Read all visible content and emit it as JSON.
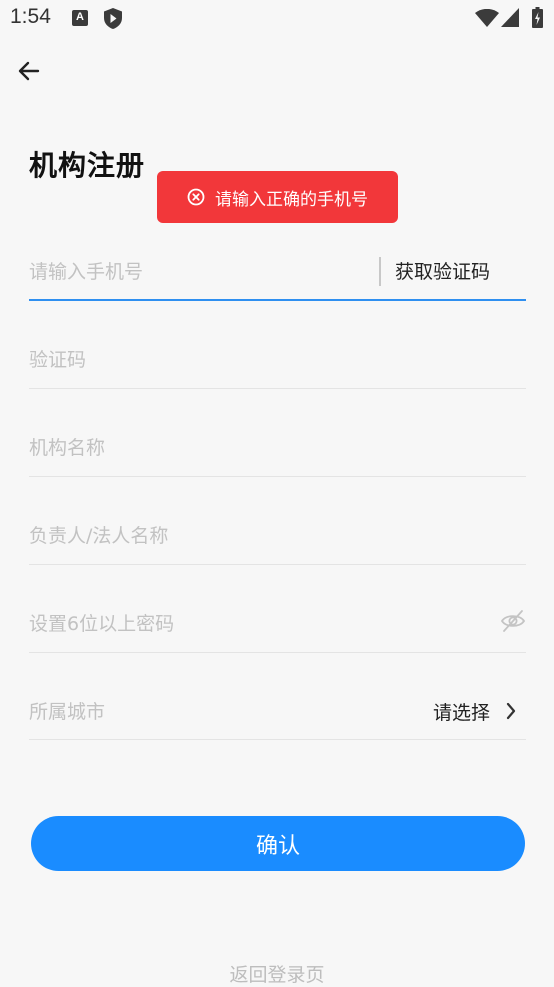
{
  "status_bar": {
    "time": "1:54",
    "a_icon_letter": "A",
    "icons": [
      "a-icon",
      "shield-icon",
      "wifi-icon",
      "signal-icon",
      "battery-icon"
    ]
  },
  "nav": {
    "back_icon": "arrow-left-icon"
  },
  "page": {
    "title": "机构注册"
  },
  "toast": {
    "icon": "close-circle-icon",
    "message": "请输入正确的手机号",
    "color": "#f2373a"
  },
  "form": {
    "phone": {
      "placeholder": "请输入手机号",
      "value": ""
    },
    "get_code_label": "获取验证码",
    "code": {
      "placeholder": "验证码",
      "value": ""
    },
    "org_name": {
      "placeholder": "机构名称",
      "value": ""
    },
    "legal_person": {
      "placeholder": "负责人/法人名称",
      "value": ""
    },
    "password": {
      "placeholder": "设置6位以上密码",
      "value": "",
      "visibility_icon": "eye-off-icon"
    },
    "city": {
      "label": "所属城市",
      "select_label": "请选择",
      "chevron_icon": "chevron-right-icon"
    }
  },
  "actions": {
    "confirm_label": "确认",
    "back_to_login_label": "返回登录页"
  },
  "colors": {
    "accent": "#1a8cff",
    "active_underline": "#2f8ff0",
    "background": "#f7f7f7"
  }
}
